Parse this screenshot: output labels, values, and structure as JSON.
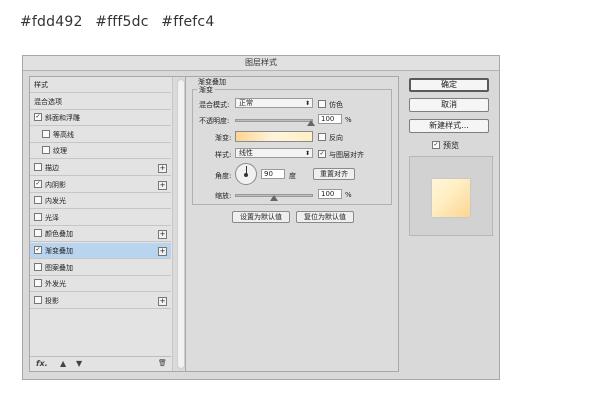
{
  "caption": {
    "color1": "#fdd492",
    "color2": "#fff5dc",
    "color3": "#ffefc4"
  },
  "dialog": {
    "title": "图层样式",
    "left_list": {
      "items": [
        {
          "label": "样式",
          "checkbox": false,
          "checked": false,
          "plus": false,
          "selected": false,
          "indent": false
        },
        {
          "label": "混合选项",
          "checkbox": false,
          "checked": false,
          "plus": false,
          "selected": false,
          "indent": false
        },
        {
          "label": "斜面和浮雕",
          "checkbox": true,
          "checked": true,
          "plus": false,
          "selected": false,
          "indent": false
        },
        {
          "label": "等高线",
          "checkbox": true,
          "checked": false,
          "plus": false,
          "selected": false,
          "indent": true
        },
        {
          "label": "纹理",
          "checkbox": true,
          "checked": false,
          "plus": false,
          "selected": false,
          "indent": true
        },
        {
          "label": "描边",
          "checkbox": true,
          "checked": false,
          "plus": true,
          "selected": false,
          "indent": false
        },
        {
          "label": "内阴影",
          "checkbox": true,
          "checked": true,
          "plus": true,
          "selected": false,
          "indent": false
        },
        {
          "label": "内发光",
          "checkbox": true,
          "checked": false,
          "plus": false,
          "selected": false,
          "indent": false
        },
        {
          "label": "光泽",
          "checkbox": true,
          "checked": false,
          "plus": false,
          "selected": false,
          "indent": false
        },
        {
          "label": "颜色叠加",
          "checkbox": true,
          "checked": false,
          "plus": true,
          "selected": false,
          "indent": false
        },
        {
          "label": "渐变叠加",
          "checkbox": true,
          "checked": true,
          "plus": true,
          "selected": true,
          "indent": false
        },
        {
          "label": "图案叠加",
          "checkbox": true,
          "checked": false,
          "plus": false,
          "selected": false,
          "indent": false
        },
        {
          "label": "外发光",
          "checkbox": true,
          "checked": false,
          "plus": false,
          "selected": false,
          "indent": false
        },
        {
          "label": "投影",
          "checkbox": true,
          "checked": false,
          "plus": true,
          "selected": false,
          "indent": false
        }
      ],
      "footer": {
        "fx": "fx.",
        "up": "▲",
        "down": "▼",
        "trash": "🗑"
      }
    },
    "panel": {
      "title": "渐变叠加",
      "group": "渐变",
      "blend_mode_label": "混合模式:",
      "blend_mode_value": "正常",
      "dither_label": "仿色",
      "opacity_label": "不透明度:",
      "opacity_value": "100",
      "opacity_unit": "%",
      "gradient_label": "渐变:",
      "reverse_label": "反向",
      "style_label": "样式:",
      "style_value": "线性",
      "align_label": "与图层对齐",
      "angle_label": "角度:",
      "angle_value": "90",
      "angle_unit": "度",
      "reset_align_button": "重置对齐",
      "scale_label": "缩放:",
      "scale_value": "100",
      "scale_unit": "%",
      "make_default_button": "设置为默认值",
      "reset_default_button": "复位为默认值",
      "gradient_colors": [
        "#fdd492",
        "#fff5dc",
        "#ffefc4"
      ]
    },
    "right": {
      "ok_button": "确定",
      "cancel_button": "取消",
      "new_style_button": "新建样式...",
      "preview_label": "预览",
      "preview_checked": true
    }
  }
}
